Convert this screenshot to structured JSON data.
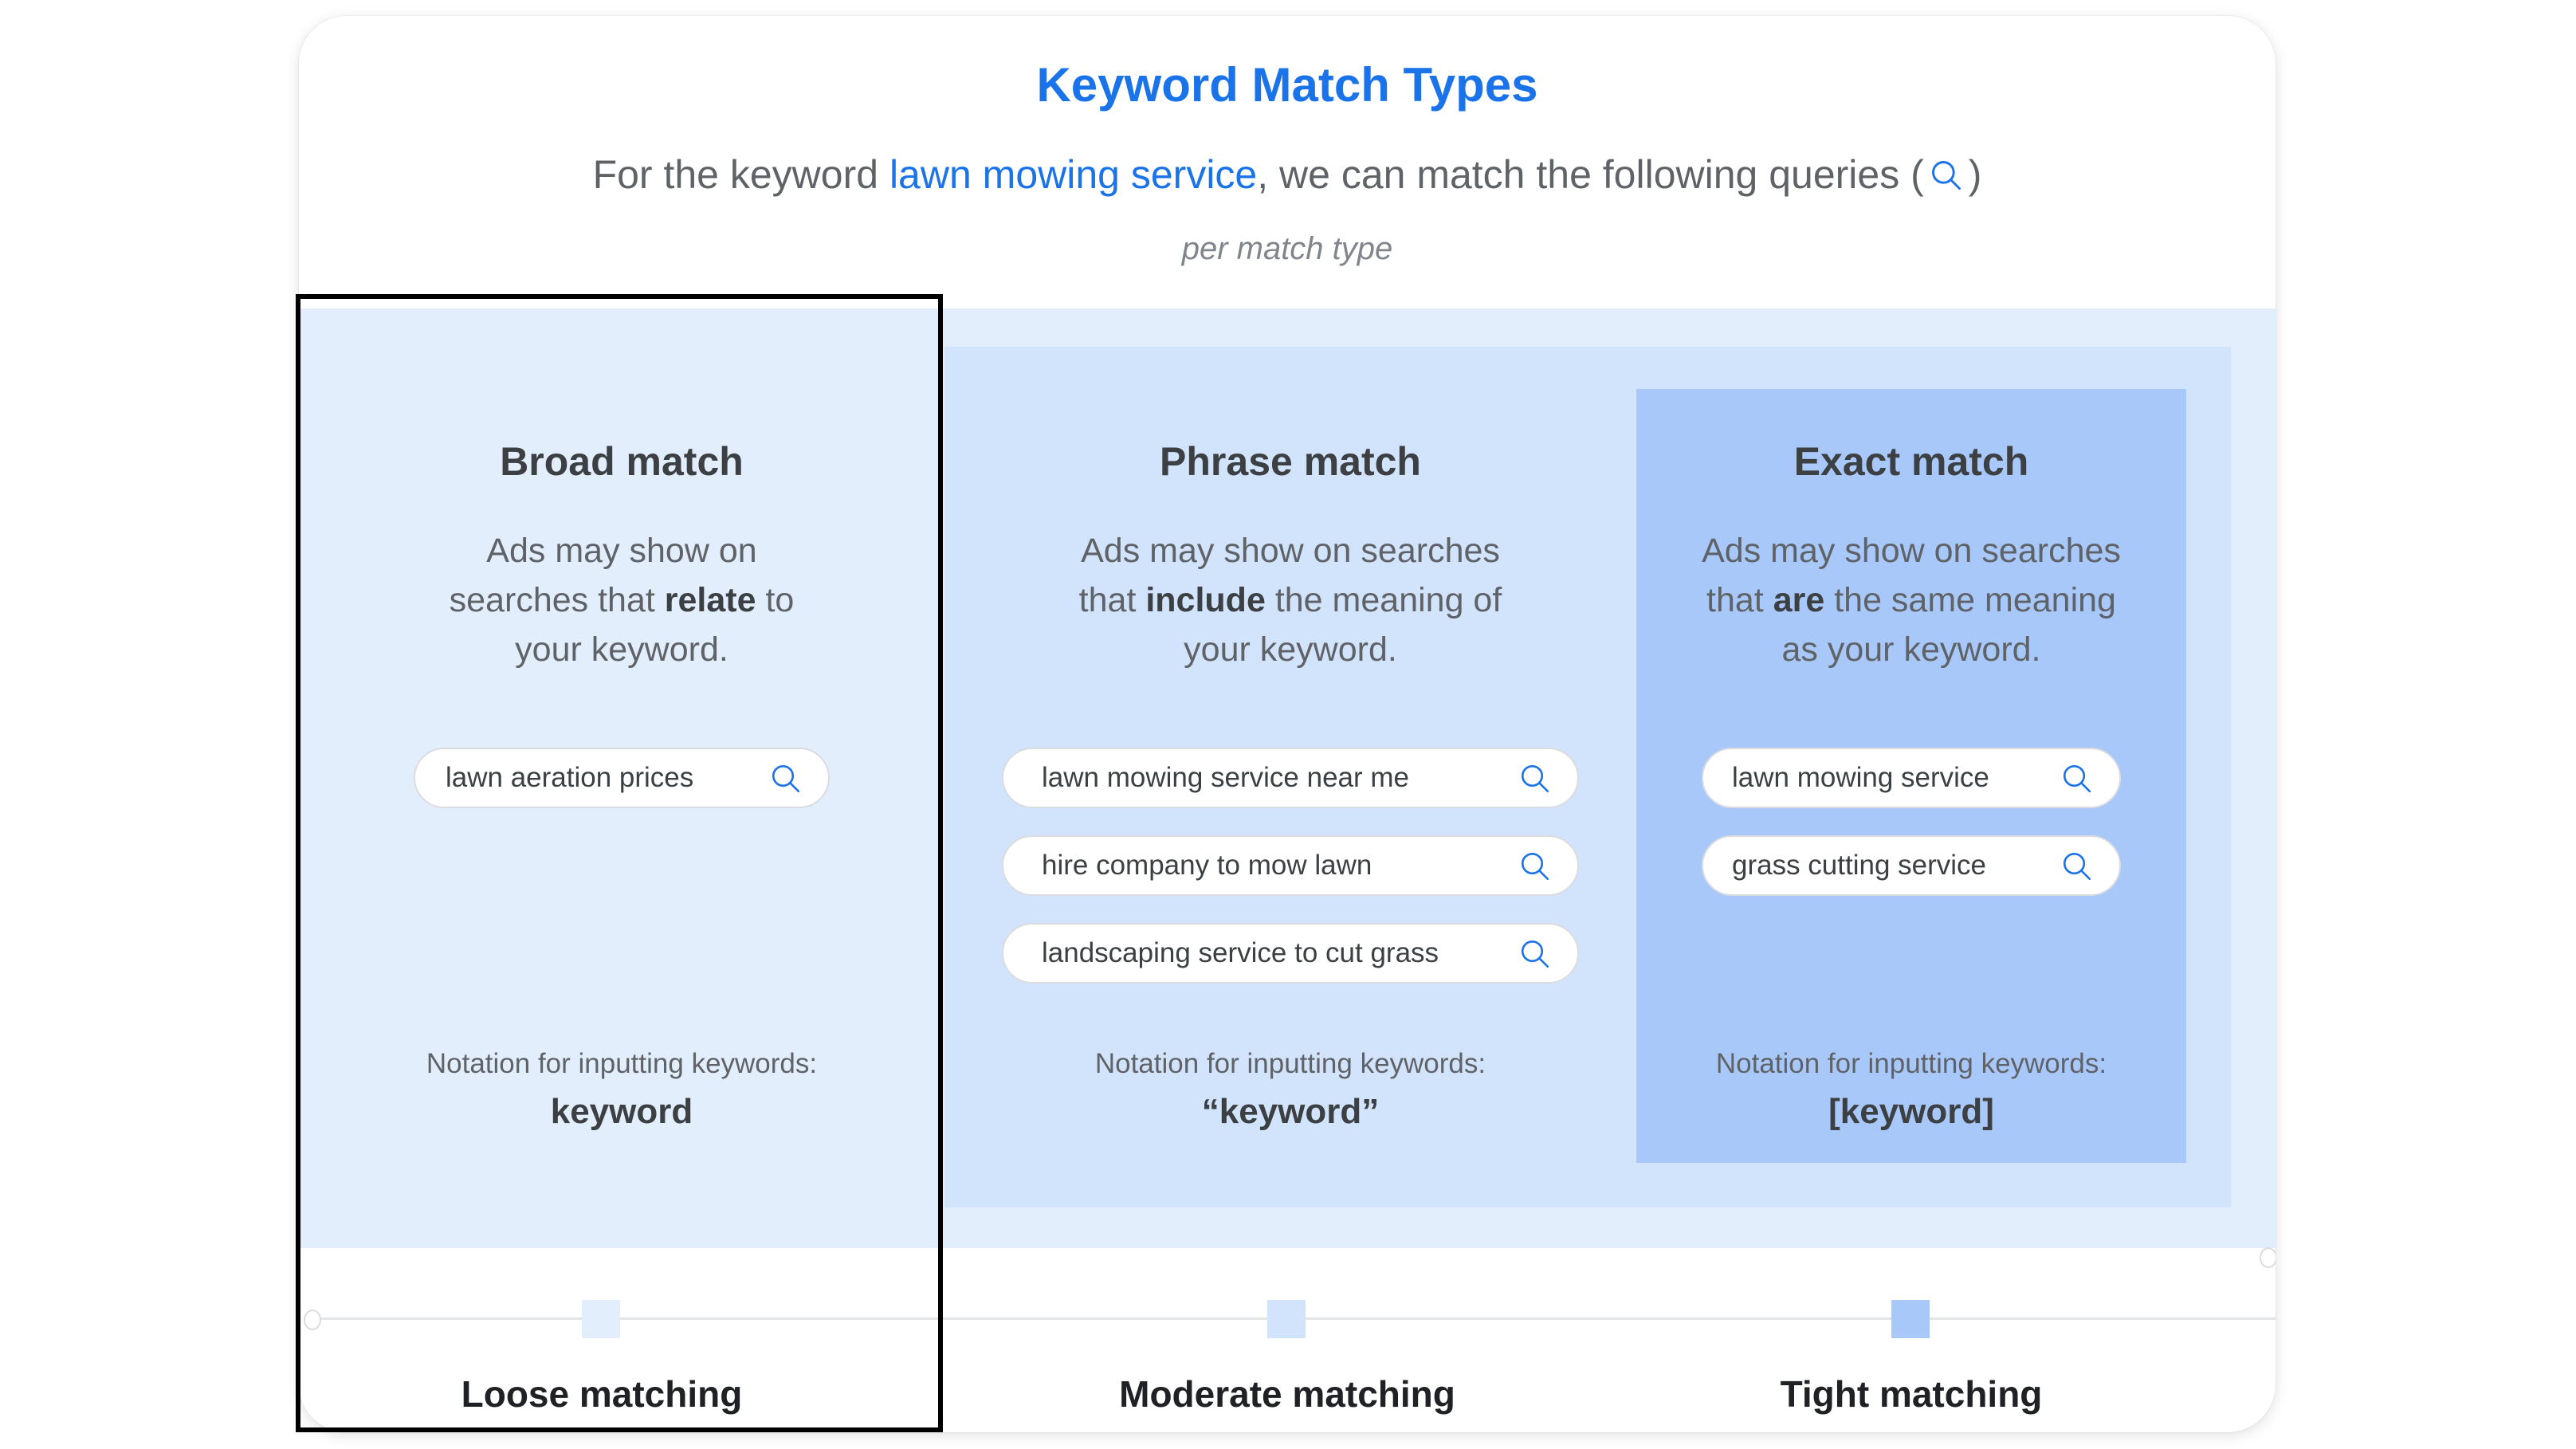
{
  "header": {
    "title": "Keyword Match Types",
    "subtitle_prefix": "For the keyword ",
    "subtitle_keyword": "lawn mowing service",
    "subtitle_suffix": ", we can match the following queries (",
    "subtitle_close": ")",
    "subtitle_icon": "search-icon",
    "per_match_type": "per match type"
  },
  "colors": {
    "accent": "#1a73e8",
    "broad_bg": "#e3eefd",
    "phrase_bg": "#d2e3fc",
    "exact_bg": "#a8c8fa",
    "highlight_border": "#000000"
  },
  "match_types": [
    {
      "name": "Broad match",
      "desc_before": "Ads may show on searches that ",
      "desc_bold": "relate",
      "desc_after": " to your keyword.",
      "queries": [
        "lawn aeration prices"
      ],
      "notation_label": "Notation for inputting keywords:",
      "notation": "keyword",
      "scale_label": "Loose matching"
    },
    {
      "name": "Phrase match",
      "desc_before": "Ads may show on searches that ",
      "desc_bold": "include",
      "desc_after": " the meaning of your keyword.",
      "queries": [
        "lawn mowing service near me",
        "hire company to mow lawn",
        "landscaping service to cut grass"
      ],
      "notation_label": "Notation for inputting keywords:",
      "notation": "“keyword”",
      "scale_label": "Moderate matching"
    },
    {
      "name": "Exact match",
      "desc_before": "Ads may show on searches that ",
      "desc_bold": "are",
      "desc_after": " the same meaning as your keyword.",
      "queries": [
        "lawn mowing service",
        "grass cutting service"
      ],
      "notation_label": "Notation for inputting keywords:",
      "notation": "[keyword]",
      "scale_label": "Tight matching"
    }
  ],
  "highlighted_column": "Broad match"
}
